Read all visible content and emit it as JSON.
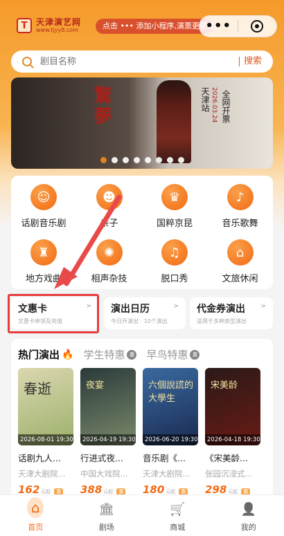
{
  "app": {
    "logo_title": "天津演艺网",
    "logo_sub": "www.tjyy8.com",
    "tip": "点击 ••• 添加小程序,演票更便捷"
  },
  "search": {
    "placeholder": "剧目名称",
    "button": "搜索"
  },
  "banner": {
    "title": "驚夢",
    "city": "天津站",
    "date": "2026.03.24",
    "launch": "全网开票",
    "slide_count": 8,
    "active_slide": 0
  },
  "categories": [
    {
      "label": "话剧音乐剧",
      "icon": "drama-mask-icon"
    },
    {
      "label": "亲子",
      "icon": "child-face-icon"
    },
    {
      "label": "国粹京昆",
      "icon": "opera-mask-icon"
    },
    {
      "label": "音乐歌舞",
      "icon": "violin-icon"
    },
    {
      "label": "地方戏曲",
      "icon": "local-opera-icon"
    },
    {
      "label": "相声杂技",
      "icon": "fan-icon"
    },
    {
      "label": "脱口秀",
      "icon": "microphone-icon"
    },
    {
      "label": "文旅休闲",
      "icon": "pavilion-icon"
    }
  ],
  "quick_cards": [
    {
      "title": "文惠卡",
      "sub": "文惠卡申领及充值"
    },
    {
      "title": "演出日历",
      "sub": "今日开演出 · 10个演出"
    },
    {
      "title": "代金券演出",
      "sub": "适用于多种类型演出"
    }
  ],
  "hot": {
    "tabs": [
      {
        "label": "热门演出"
      },
      {
        "label": "学生特惠",
        "badge": "惠"
      },
      {
        "label": "早鸟特惠",
        "badge": "惠"
      }
    ],
    "shows": [
      {
        "date": "2026-08-01 19:30",
        "name": "话剧九人...",
        "venue": "天津大剧院...",
        "price": "162",
        "unit": "元起",
        "tag": "惠",
        "poster_text": "春逝",
        "colors": [
          "#dcd7b0",
          "#9ab06a"
        ]
      },
      {
        "date": "2026-04-19 19:30",
        "name": "行进式夜...",
        "venue": "中国大戏院...",
        "price": "388",
        "unit": "元起",
        "tag": "惠",
        "poster_text": "夜宴",
        "colors": [
          "#2a3a3a",
          "#7a8a6a"
        ]
      },
      {
        "date": "2026-06-20 19:30",
        "name": "音乐剧《...",
        "venue": "天津大剧院...",
        "price": "180",
        "unit": "元起",
        "tag": "惠",
        "poster_text": "六個說謊的大學生",
        "colors": [
          "#3a6aa0",
          "#1a2a50"
        ]
      },
      {
        "date": "2026-04-18 19:30",
        "name": "《宋美龄...",
        "venue": "张园沉浸式...",
        "price": "298",
        "unit": "元起",
        "tag": "惠",
        "poster_text": "宋美龄",
        "colors": [
          "#2a1a18",
          "#6a1a14"
        ]
      }
    ]
  },
  "tabbar": [
    {
      "label": "首页",
      "icon": "home-icon",
      "active": true
    },
    {
      "label": "剧场",
      "icon": "theater-icon"
    },
    {
      "label": "商城",
      "icon": "cart-icon"
    },
    {
      "label": "我的",
      "icon": "user-icon"
    }
  ],
  "colors": {
    "accent": "#f16a12",
    "highlight": "#e63b3b",
    "header": "#f59a2a"
  }
}
